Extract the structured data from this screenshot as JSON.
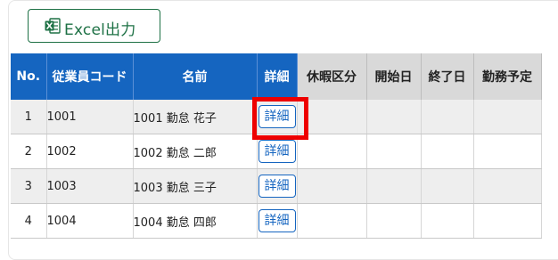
{
  "toolbar": {
    "excel_button_label": "Excel出力",
    "excel_icon": "excel-file-icon",
    "excel_brand_color": "#1e7145"
  },
  "table": {
    "columns": [
      {
        "label": "No.",
        "style": "blue"
      },
      {
        "label": "従業員コード",
        "style": "blue"
      },
      {
        "label": "名前",
        "style": "blue"
      },
      {
        "label": "詳細",
        "style": "blue"
      },
      {
        "label": "休暇区分",
        "style": "gray"
      },
      {
        "label": "開始日",
        "style": "gray"
      },
      {
        "label": "終了日",
        "style": "gray"
      },
      {
        "label": "勤務予定",
        "style": "gray"
      }
    ],
    "rows": [
      {
        "no": "1",
        "code": "1001",
        "name": "1001 勤怠 花子",
        "detail": "詳細",
        "leave_type": "",
        "start_date": "",
        "end_date": "",
        "schedule": ""
      },
      {
        "no": "2",
        "code": "1002",
        "name": "1002 勤怠 二郎",
        "detail": "詳細",
        "leave_type": "",
        "start_date": "",
        "end_date": "",
        "schedule": ""
      },
      {
        "no": "3",
        "code": "1003",
        "name": "1003 勤怠 三子",
        "detail": "詳細",
        "leave_type": "",
        "start_date": "",
        "end_date": "",
        "schedule": ""
      },
      {
        "no": "4",
        "code": "1004",
        "name": "1004 勤怠 四郎",
        "detail": "詳細",
        "leave_type": "",
        "start_date": "",
        "end_date": "",
        "schedule": ""
      }
    ],
    "row_colors": [
      "#eeeeee",
      "#ffffff"
    ],
    "header_blue": "#1565c0",
    "header_gray": "#d9d9d9"
  },
  "annotation": {
    "highlight_color": "#ee0000"
  }
}
